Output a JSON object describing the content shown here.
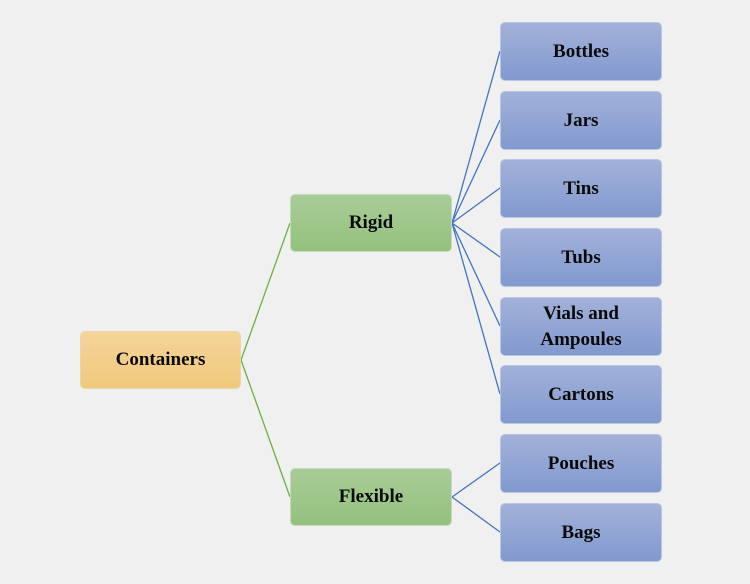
{
  "diagram": {
    "type": "tree",
    "root": {
      "id": "containers",
      "label": "Containers",
      "color": "#efc97c",
      "children": [
        {
          "id": "rigid",
          "label": "Rigid",
          "color": "#94c17e",
          "connector_color": "#70ad47",
          "children": [
            {
              "id": "bottles",
              "label": "Bottles"
            },
            {
              "id": "jars",
              "label": "Jars"
            },
            {
              "id": "tins",
              "label": "Tins"
            },
            {
              "id": "tubs",
              "label": "Tubs"
            },
            {
              "id": "vials",
              "label": "Vials and Ampoules"
            },
            {
              "id": "cartons",
              "label": "Cartons"
            }
          ]
        },
        {
          "id": "flexible",
          "label": "Flexible",
          "color": "#94c17e",
          "connector_color": "#70ad47",
          "children": [
            {
              "id": "pouches",
              "label": "Pouches"
            },
            {
              "id": "bags",
              "label": "Bags"
            }
          ]
        }
      ]
    },
    "leaf_color": "#8299cf",
    "leaf_connector_color": "#4472c4"
  },
  "labels": {
    "containers": "Containers",
    "rigid": "Rigid",
    "flexible": "Flexible",
    "bottles": "Bottles",
    "jars": "Jars",
    "tins": "Tins",
    "tubs": "Tubs",
    "vials_line1": "Vials and",
    "vials_line2": "Ampoules",
    "cartons": "Cartons",
    "pouches": "Pouches",
    "bags": "Bags"
  }
}
